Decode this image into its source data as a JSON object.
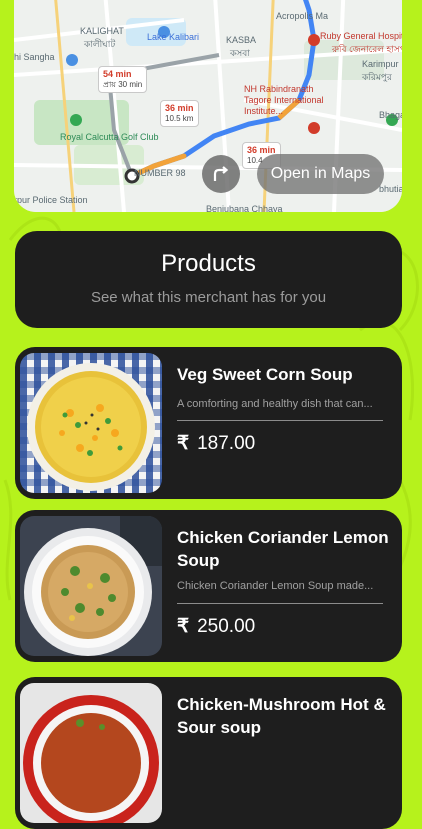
{
  "map": {
    "labels": {
      "kalighat": "KALIGHAT",
      "kalighat_local": "কালীঘাট",
      "lake_kalibari": "Lake Kalibari",
      "kasba": "KASBA",
      "kasba_local": "কসবা",
      "acropolis": "Acropolis Ma",
      "ruby_hospital": "Ruby General Hospital",
      "ruby_local": "রুবি জেনারেল হাসপাতাল",
      "karimpur": "Karimpur",
      "karimpur_local": "করিমপুর",
      "rabindranath": "NH Rabindranath Tagore International Institute...",
      "shri_sangha": "hi Sangha",
      "royal_golf": "Royal Calcutta Golf Club",
      "police_station": "rpur Police Station",
      "benjubana": "Benjubana Chhaya",
      "bhaga": "Bhaga",
      "bhutia": "bhutia",
      "number98": "NUMBER 98"
    },
    "routes": [
      {
        "time": "54 min",
        "sub": "প্রায় 30 min"
      },
      {
        "time": "36 min",
        "sub": "10.5 km"
      },
      {
        "time": "36 min",
        "sub": "10.4"
      }
    ],
    "open_maps_label": "Open in Maps"
  },
  "products_header": {
    "title": "Products",
    "subtitle": "See what this merchant has for you"
  },
  "products": [
    {
      "name": "Veg Sweet Corn Soup",
      "description": "A comforting and healthy dish that can...",
      "currency": "₹",
      "price": "187.00"
    },
    {
      "name": "Chicken Coriander Lemon Soup",
      "description": "Chicken Coriander Lemon Soup made...",
      "currency": "₹",
      "price": "250.00"
    },
    {
      "name": "Chicken-Mushroom Hot & Sour soup",
      "description": "",
      "currency": "₹",
      "price": ""
    }
  ],
  "colors": {
    "background": "#b6f21c",
    "card": "#1e1e1e",
    "route": "#4285f4",
    "traffic": "#f2a33a"
  }
}
